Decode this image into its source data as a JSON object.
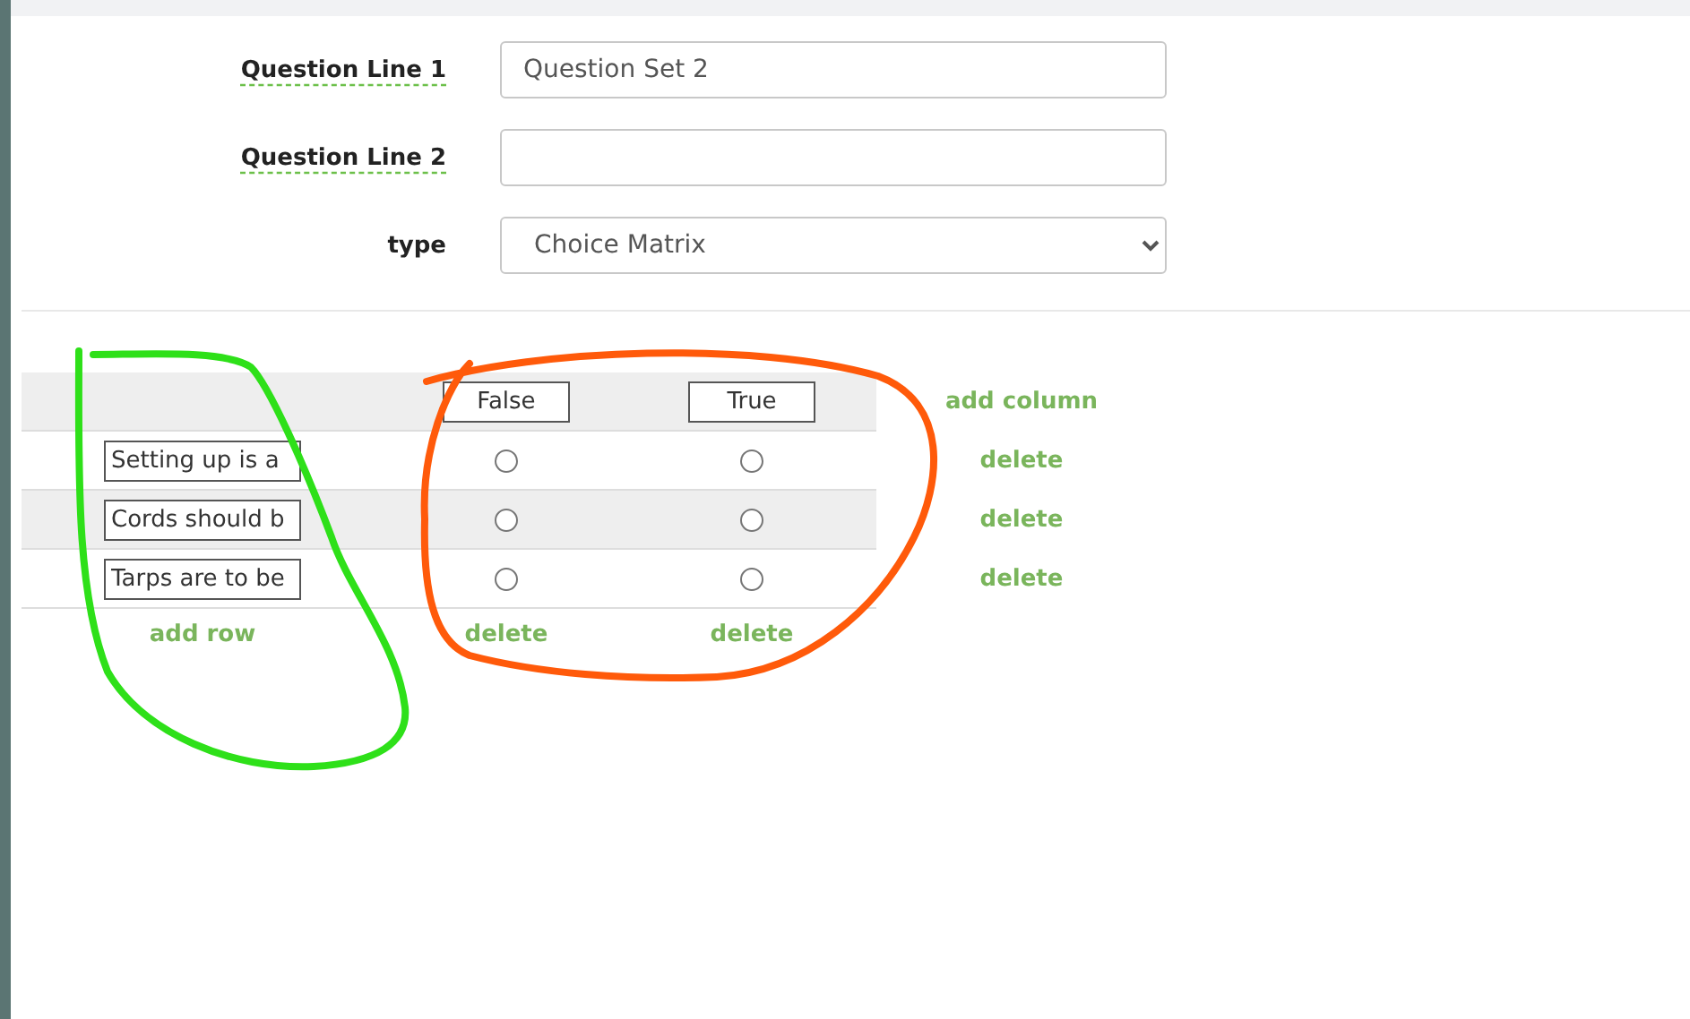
{
  "form": {
    "fields": [
      {
        "kind": "text",
        "label": "Question Line 1",
        "value": "Question Set 2"
      },
      {
        "kind": "text",
        "label": "Question Line 2"
      },
      {
        "kind": "select",
        "label": "type",
        "value": "Choice Matrix"
      }
    ]
  },
  "matrix": {
    "columns": [
      {
        "label": "False",
        "delete": "delete"
      },
      {
        "label": "True",
        "delete": "delete"
      }
    ],
    "add_column": "add column",
    "rows": [
      {
        "statement": "Setting up is a",
        "choices": [
          {
            "checked": false
          },
          {
            "checked": false
          }
        ],
        "delete": "delete"
      },
      {
        "statement": "Cords should b",
        "choices": [
          {
            "checked": false
          },
          {
            "checked": false
          }
        ],
        "delete": "delete"
      },
      {
        "statement": "Tarps are to be",
        "choices": [
          {
            "checked": false
          },
          {
            "checked": false
          }
        ],
        "delete": "delete"
      }
    ],
    "add_row": "add row"
  },
  "annotations": [
    {
      "kind": "loop",
      "color": "#2ee019"
    },
    {
      "kind": "loop",
      "color": "#ff5a0a"
    }
  ]
}
